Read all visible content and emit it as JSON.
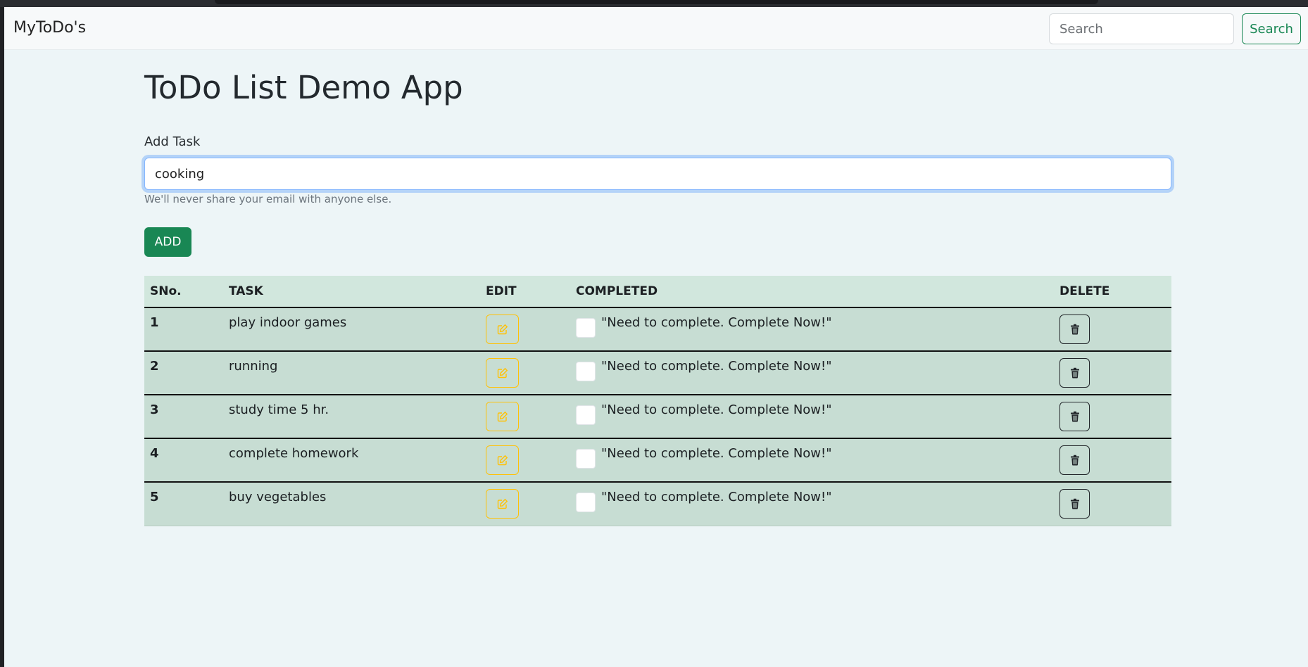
{
  "navbar": {
    "brand": "MyToDo's",
    "search_placeholder": "Search",
    "search_button": "Search"
  },
  "main": {
    "title": "ToDo List Demo App",
    "add_label": "Add Task",
    "task_input_value": "cooking",
    "help_text": "We'll never share your email with anyone else.",
    "add_button": "ADD"
  },
  "table": {
    "columns": [
      "SNo.",
      "TASK",
      "EDIT",
      "COMPLETED",
      "DELETE"
    ],
    "rows": [
      {
        "sno": "1",
        "task": "play indoor games",
        "status": "\"Need to complete. Complete Now!\""
      },
      {
        "sno": "2",
        "task": "running",
        "status": "\"Need to complete. Complete Now!\""
      },
      {
        "sno": "3",
        "task": "study time 5 hr.",
        "status": "\"Need to complete. Complete Now!\""
      },
      {
        "sno": "4",
        "task": "complete homework",
        "status": "\"Need to complete. Complete Now!\""
      },
      {
        "sno": "5",
        "task": "buy vegetables",
        "status": "\"Need to complete. Complete Now!\""
      }
    ]
  },
  "icons": {
    "edit": "pencil-square-icon",
    "delete": "trash-icon"
  },
  "colors": {
    "success": "#198754",
    "warning": "#ffc107",
    "table_header": "#d1e7dd",
    "table_row": "#c7ddd3",
    "page_bg": "#edf5f7"
  }
}
